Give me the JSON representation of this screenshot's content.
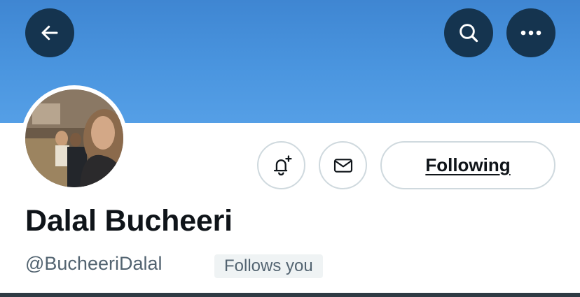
{
  "header": {
    "back_icon": "arrow-left-icon",
    "search_icon": "search-icon",
    "more_icon": "more-horizontal-icon",
    "banner_color": "#4a95df",
    "button_color": "#15344f"
  },
  "profile": {
    "display_name": "Dalal Bucheeri",
    "handle": "@BucheeriDalal",
    "follows_you": "Follows you"
  },
  "actions": {
    "notify_icon": "bell-plus-icon",
    "message_icon": "envelope-icon",
    "following_label": "Following"
  }
}
